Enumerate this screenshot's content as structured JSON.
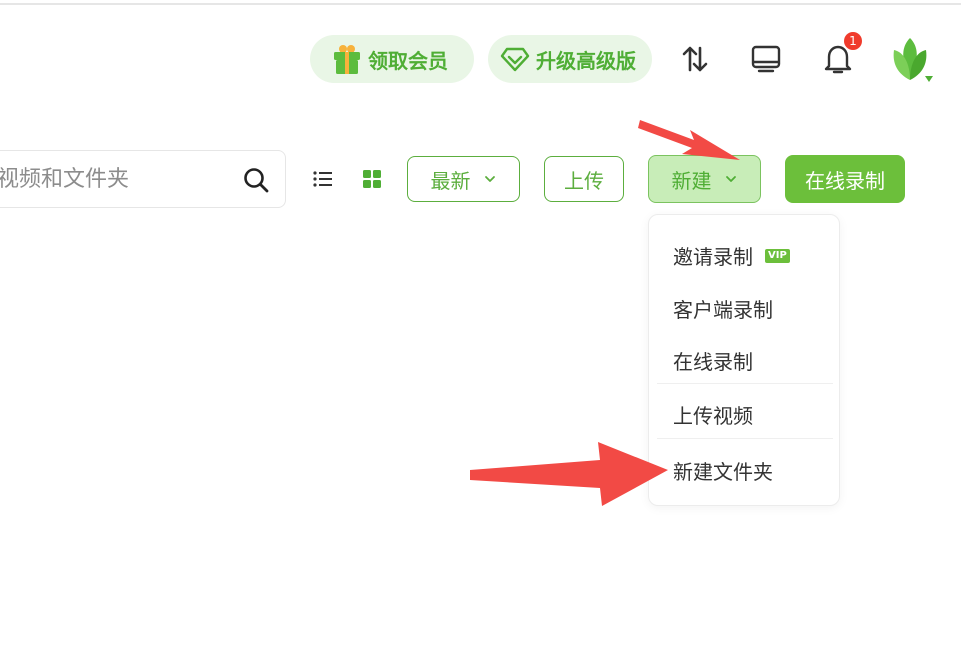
{
  "header": {
    "member_label": "领取会员",
    "upgrade_label": "升级高级版",
    "notification_count": "1"
  },
  "toolbar": {
    "search_placeholder": "视频和文件夹",
    "sort_label": "最新",
    "upload_label": "上传",
    "new_label": "新建",
    "record_label": "在线录制"
  },
  "new_menu": {
    "items": [
      {
        "label": "邀请录制",
        "badge": "VIP"
      },
      {
        "label": "客户端录制"
      },
      {
        "label": "在线录制"
      },
      {
        "label": "上传视频"
      },
      {
        "label": "新建文件夹"
      }
    ]
  },
  "colors": {
    "brand_green": "#6cbf3b",
    "pill_bg": "#e9f6e6",
    "new_button_bg": "#c8edb8",
    "badge_red": "#f03b2c",
    "annotation_arrow": "#f24a45"
  }
}
